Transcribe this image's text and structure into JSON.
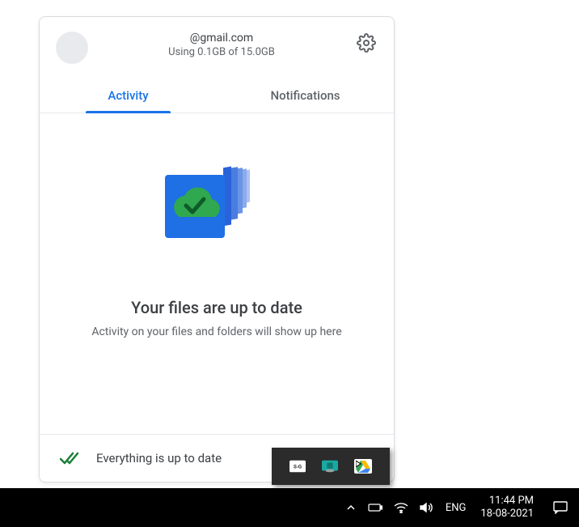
{
  "drive": {
    "account": {
      "email": "@gmail.com",
      "storage": "Using 0.1GB of 15.0GB"
    },
    "tabs": {
      "activity": "Activity",
      "notifications": "Notifications"
    },
    "content": {
      "title": "Your files are up to date",
      "subtitle": "Activity on your files and folders will show up here"
    },
    "footer": {
      "status": "Everything is up to date"
    }
  },
  "tray_overflow": {
    "items": [
      "screen2gif-icon",
      "touchpad-icon",
      "drive-icon"
    ]
  },
  "taskbar": {
    "lang": "ENG",
    "time": "11:44 PM",
    "date": "18-08-2021"
  }
}
